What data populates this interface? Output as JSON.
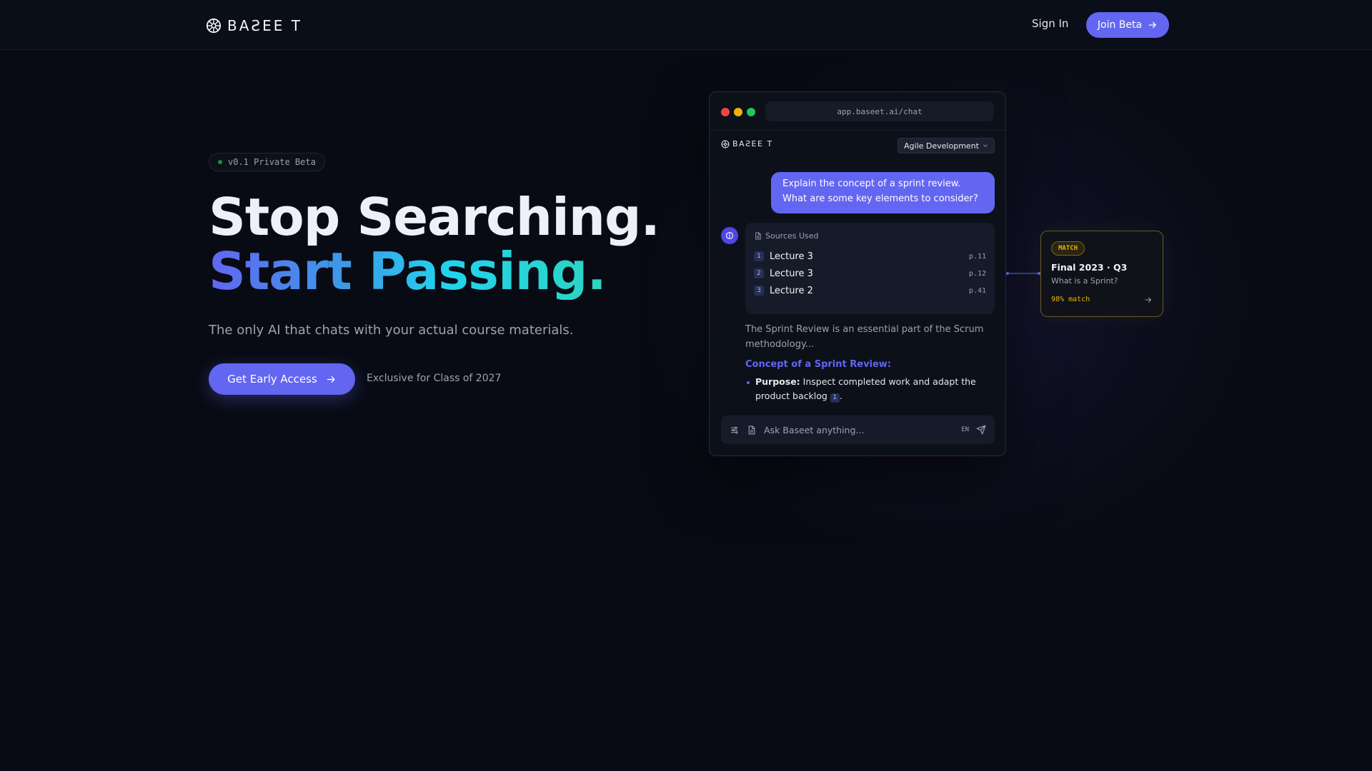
{
  "nav": {
    "brand": "BA𝘚EE T",
    "brand_text": "BAƧEE T",
    "sign_in": "Sign In",
    "join_beta": "Join Beta"
  },
  "hero": {
    "badge": "v0.1 Private Beta",
    "headline_1": "Stop Searching.",
    "headline_2": "Start Passing.",
    "subtitle": "The only AI that chats with your actual course materials.",
    "cta": "Get Early Access",
    "exclusive": "Exclusive for Class of 2027"
  },
  "app": {
    "url": "app.baseet.ai/chat",
    "brand": "BAƧEE T",
    "course": "Agile Development",
    "user_message_line1": "Explain the concept of a sprint review.",
    "user_message_line2": "What are some key elements to consider?",
    "sources_heading": "Sources Used",
    "sources": [
      {
        "num": "1",
        "name": "Lecture 3",
        "page": "p.11"
      },
      {
        "num": "2",
        "name": "Lecture 3",
        "page": "p.12"
      },
      {
        "num": "3",
        "name": "Lecture 2",
        "page": "p.41"
      }
    ],
    "answer_intro": "The Sprint Review is an essential part of the Scrum methodology...",
    "concept_heading": "Concept of a Sprint Review:",
    "bullet_label": "Purpose:",
    "bullet_text": " Inspect completed work and adapt the product backlog ",
    "bullet_cite": "1",
    "bullet_end": ".",
    "composer_placeholder": "Ask Baseet anything...",
    "language": "EN"
  },
  "match_card": {
    "tag": "MATCH",
    "title": "Final 2023 · Q3",
    "question": "What is a Sprint?",
    "score": "98% match"
  },
  "colors": {
    "background": "#080b14",
    "accent": "#6366f1",
    "teal": "#2dd4bf",
    "gold": "#eab308"
  },
  "icons": {
    "brand": "aperture-icon",
    "join_arrow": "arrow-right-icon",
    "cta_arrow": "arrow-right-icon",
    "course_chevron": "chevron-down-icon",
    "sources": "document-icon",
    "settings": "sliders-icon",
    "attach": "file-icon",
    "send": "send-icon",
    "match_arrow": "arrow-right-icon"
  }
}
